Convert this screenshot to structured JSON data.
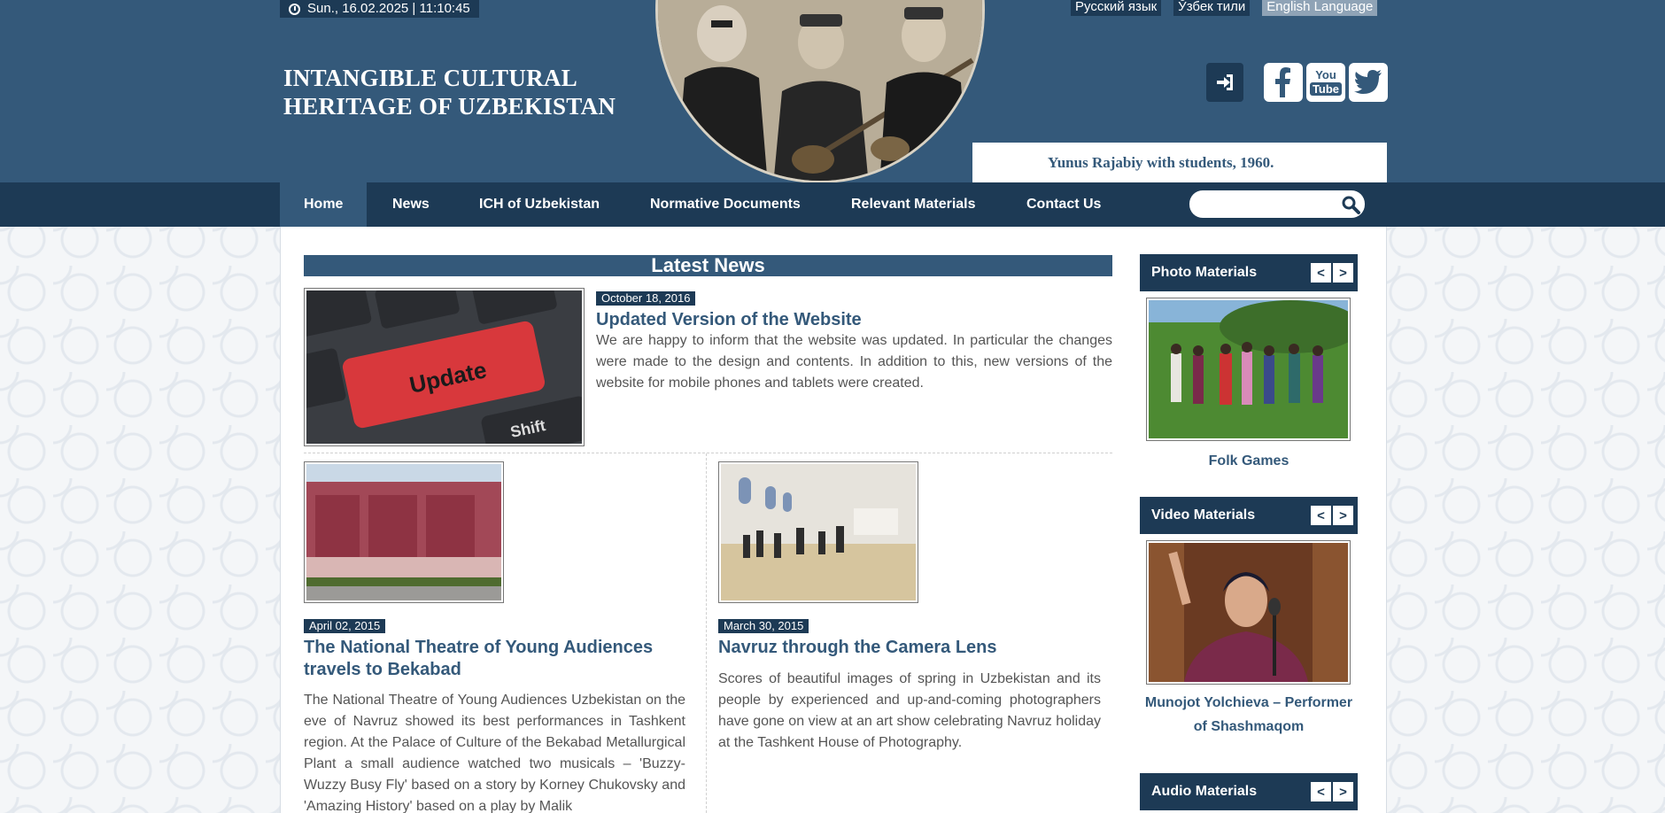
{
  "header": {
    "datetime": "Sun., 16.02.2025 | 11:10:45",
    "logo_line1": "INTANGIBLE CULTURAL",
    "logo_line2": "HERITAGE OF UZBEKISTAN",
    "photo_caption": "Yunus Rajabiy with students, 1960.",
    "languages": [
      "Русский язык",
      "Ўзбек тили",
      "English Language"
    ],
    "active_language": "English Language",
    "youtube_label_top": "You",
    "youtube_label_bottom": "Tube"
  },
  "nav": {
    "items": [
      "Home",
      "News",
      "ICH of Uzbekistan",
      "Normative Documents",
      "Relevant Materials",
      "Contact Us"
    ],
    "active": "Home",
    "search_placeholder": ""
  },
  "main": {
    "section_title": "Latest News",
    "featured": {
      "date": "October 18, 2016",
      "title": "Updated Version of the Website",
      "text": "We are happy to inform that the website was updated. In particular the changes were made to the design and contents. In addition to this, new versions of the website for mobile phones and tablets were created.",
      "image_keycap_text": "Update",
      "image_shift_text": "Shift"
    },
    "news": [
      {
        "date": "April 02, 2015",
        "title": "The National Theatre of Young Audiences travels to Bekabad",
        "text": "The National Theatre of Young Audiences Uzbekistan on the eve of Navruz showed its best performances in Tashkent region. At the Palace of Culture of the Bekabad Metallurgical Plant a small audience watched two musicals – 'Buzzy-Wuzzy Busy Fly' based on a story by Korney Chukovsky and 'Amazing History' based on a play by Malik"
      },
      {
        "date": "March 30, 2015",
        "title": "Navruz through the Camera Lens",
        "text": "Scores of beautiful images of spring in Uzbekistan and its people by experienced and up-and-coming photographers have gone on view at an art show celebrating Navruz holiday at the Tashkent House of Photography."
      }
    ]
  },
  "sidebar": {
    "photo": {
      "title": "Photo Materials",
      "caption": "Folk Games"
    },
    "video": {
      "title": "Video Materials",
      "caption_line1": "Munojot Yolchieva – Performer",
      "caption_line2": "of Shashmaqom"
    },
    "audio": {
      "title": "Audio Materials"
    },
    "prev_label": "<",
    "next_label": ">"
  },
  "colors": {
    "header_bg": "#34597a",
    "nav_bg": "#1d3a55",
    "title_color": "#34597a"
  }
}
